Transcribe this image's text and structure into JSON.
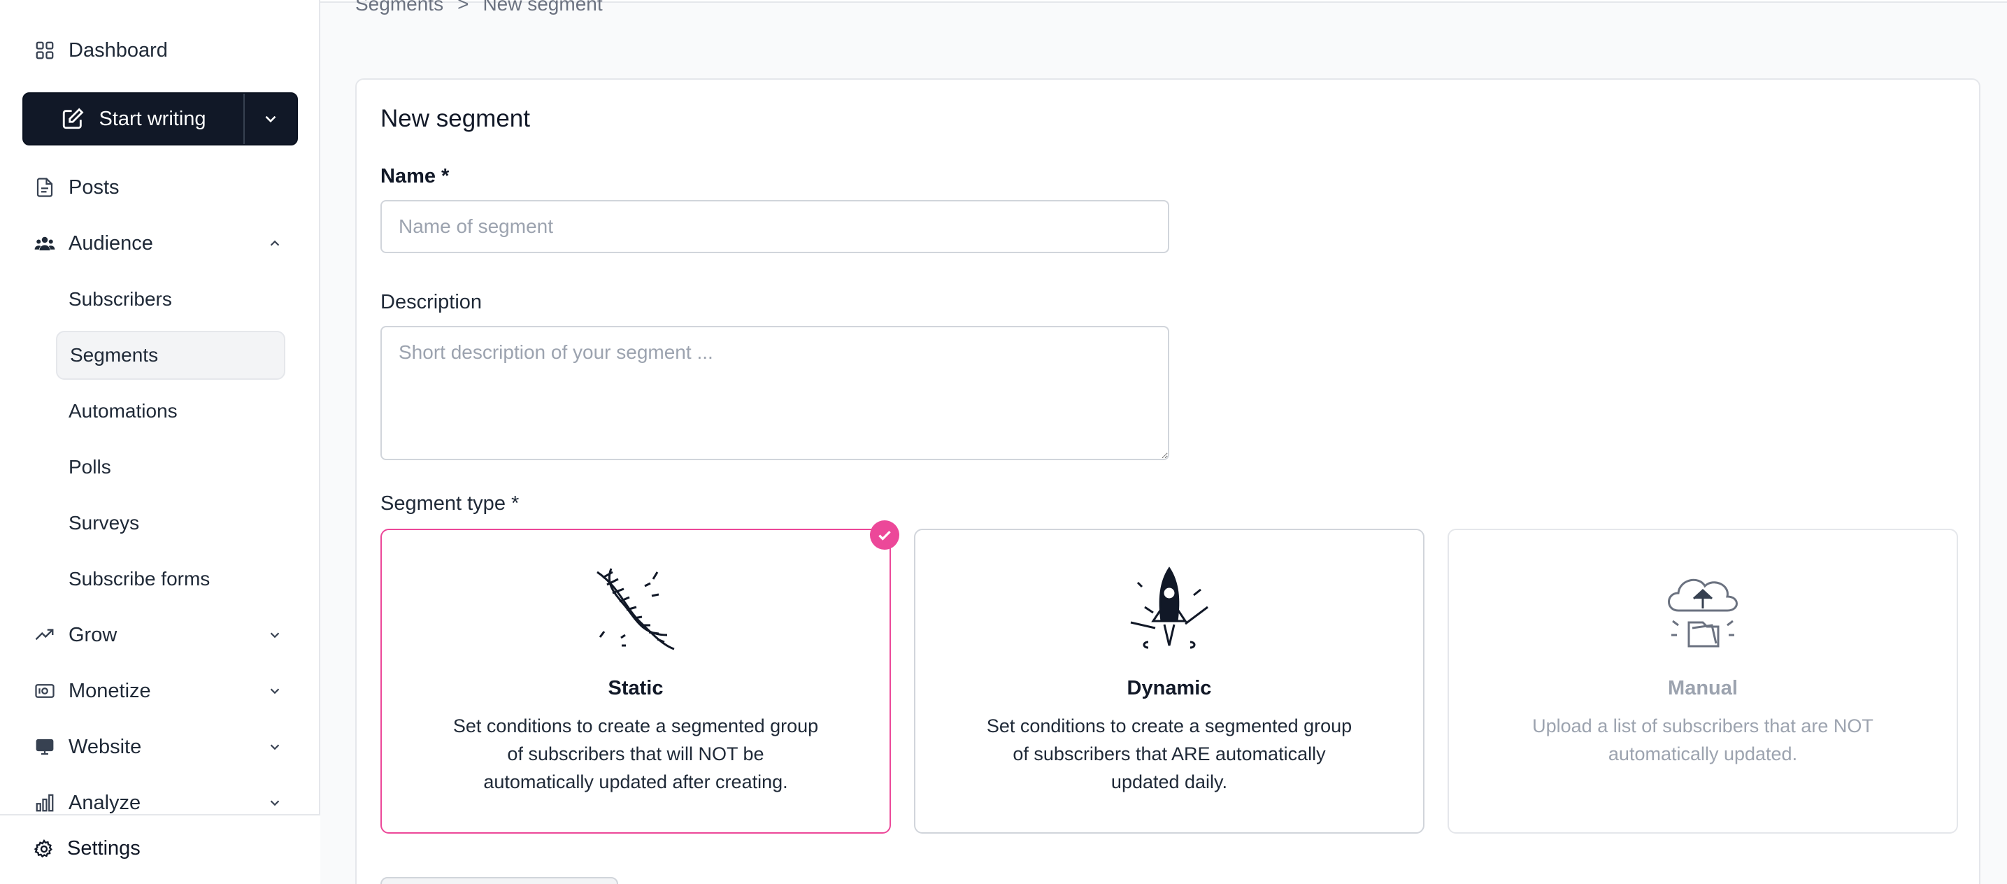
{
  "sidebar": {
    "dashboard": "Dashboard",
    "start_writing": "Start writing",
    "posts": "Posts",
    "audience": "Audience",
    "audience_items": [
      "Subscribers",
      "Segments",
      "Automations",
      "Polls",
      "Surveys",
      "Subscribe forms"
    ],
    "grow": "Grow",
    "monetize": "Monetize",
    "website": "Website",
    "analyze": "Analyze",
    "settings": "Settings"
  },
  "breadcrumb": {
    "parent": "Segments",
    "separator": ">",
    "current": "New segment"
  },
  "form": {
    "title": "New segment",
    "name_label": "Name *",
    "name_placeholder": "Name of segment",
    "name_value": "",
    "description_label": "Description",
    "description_placeholder": "Short description of your segment ...",
    "description_value": "",
    "type_label": "Segment type *",
    "types": [
      {
        "title": "Static",
        "desc": "Set conditions to create a segmented group of subscribers that will NOT be automatically updated after creating.",
        "selected": true,
        "illustration": "dna-icon"
      },
      {
        "title": "Dynamic",
        "desc": "Set conditions to create a segmented group of subscribers that ARE automatically updated daily.",
        "selected": false,
        "illustration": "rocket-icon"
      },
      {
        "title": "Manual",
        "desc": "Upload a list of subscribers that are NOT automatically updated.",
        "selected": false,
        "illustration": "cloud-upload-icon"
      }
    ]
  },
  "colors": {
    "accent": "#ec4899",
    "dark": "#111827",
    "border": "#d1d5db"
  }
}
